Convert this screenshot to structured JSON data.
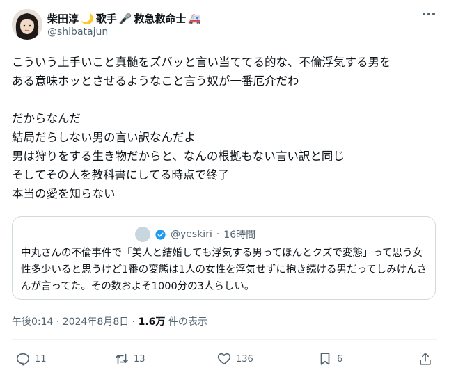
{
  "author": {
    "name": "柴田淳",
    "badges": [
      "🌙",
      "歌手",
      "🎤",
      "救急救命士",
      "🚑"
    ],
    "handle": "@shibatajun"
  },
  "tweet": {
    "text": "こういう上手いこと真髄をズバッと言い当ててる的な、不倫浮気する男を\nある意味ホッとさせるようなこと言う奴が一番厄介だわ\n\nだからなんだ\n結局だらしない男の言い訳なんだよ\n男は狩りをする生き物だからと、なんの根拠もない言い訳と同じ\nそしてその人を教科書にしてる時点で終了\n本当の愛を知らない"
  },
  "quote": {
    "handle": "@yeskiri",
    "separator": "·",
    "time": "16時間",
    "text": "中丸さんの不倫事件で「美人と結婚しても浮気する男ってほんとクズで変態」って思う女性多少いると思うけど1番の変態は1人の女性を浮気せずに抱き続ける男だってしみけんさんが言ってた。その数およそ1000分の3人らしい。"
  },
  "meta": {
    "timestamp": "午後0:14 · 2024年8月8日 · ",
    "views_count": "1.6万",
    "views_label": " 件の表示"
  },
  "actions": {
    "replies": "11",
    "reposts": "13",
    "likes": "136",
    "bookmarks": "6"
  },
  "colors": {
    "secondary_text": "#536471",
    "verified_blue": "#1d9bf0"
  },
  "icons": [
    "more-icon",
    "verified-icon",
    "reply-icon",
    "repost-icon",
    "like-icon",
    "bookmark-icon",
    "share-icon"
  ]
}
